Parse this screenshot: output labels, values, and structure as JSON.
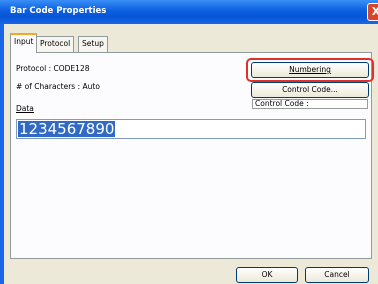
{
  "window": {
    "title": "Bar Code Properties",
    "close_glyph": "X"
  },
  "tabs": [
    {
      "label": "Input"
    },
    {
      "label": "Protocol"
    },
    {
      "label": "Setup"
    }
  ],
  "info": {
    "protocol": "Protocol : CODE128",
    "characters": "# of Characters : Auto"
  },
  "buttons": {
    "numbering": "Numbering",
    "control_code": "Control Code...",
    "ok": "OK",
    "cancel": "Cancel"
  },
  "control_code_label": "Control Code :",
  "data": {
    "label": "Data",
    "value": "1234567890"
  },
  "colors": {
    "titlebar": "#0b5fe0",
    "selection": "#316ac5",
    "highlight": "#e0302a"
  }
}
